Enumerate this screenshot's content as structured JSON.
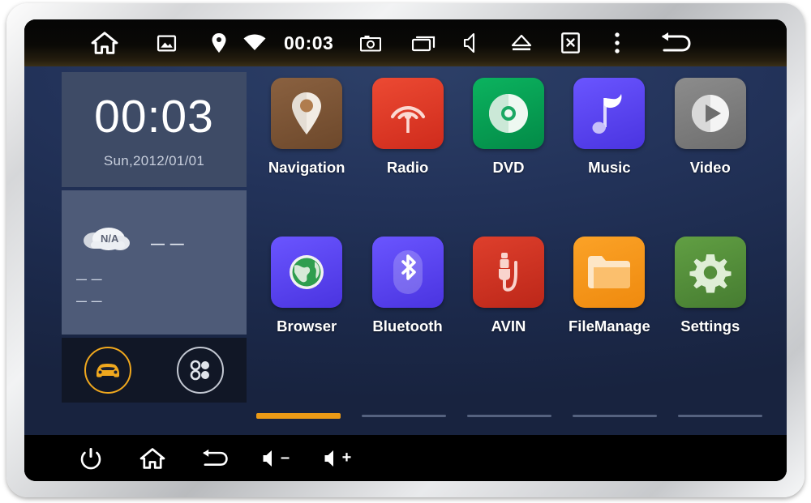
{
  "status_bar": {
    "clock": "00:03",
    "icons_left": [
      {
        "name": "home-icon",
        "label": "Home"
      },
      {
        "name": "wallpaper-icon",
        "label": "Wallpaper"
      }
    ],
    "icons_center": [
      {
        "name": "location-pin-icon",
        "label": "GPS"
      },
      {
        "name": "wifi-icon",
        "label": "Wi-Fi"
      }
    ],
    "icons_right": [
      {
        "name": "screenshot-icon",
        "label": "Screenshot"
      },
      {
        "name": "recent-apps-icon",
        "label": "Recent apps"
      },
      {
        "name": "mute-icon",
        "label": "Mute"
      },
      {
        "name": "eject-icon",
        "label": "Eject"
      },
      {
        "name": "screen-off-icon",
        "label": "Screen off"
      },
      {
        "name": "overflow-menu-icon",
        "label": "More"
      },
      {
        "name": "back-icon",
        "label": "Back"
      }
    ]
  },
  "widgets": {
    "clock": {
      "time": "00:03",
      "date": "Sun,2012/01/01"
    },
    "weather": {
      "condition": "N/A",
      "temperature": "— —",
      "low": "— —",
      "high": "— —",
      "icon": "cloud-icon"
    },
    "dock": [
      {
        "name": "car-mode-button",
        "icon": "car-icon",
        "active": true,
        "color": "#f0a81e"
      },
      {
        "name": "all-apps-button",
        "icon": "apps-grid-icon",
        "active": false,
        "color": "#c3c8d2"
      }
    ]
  },
  "apps": {
    "rows": [
      [
        {
          "label": "Navigation",
          "icon": "map-pin-icon",
          "bg": "#7b5434",
          "fg": "#f3ece4"
        },
        {
          "label": "Radio",
          "icon": "radio-waves-icon",
          "bg": "#e03a25",
          "fg": "#fbd9d2"
        },
        {
          "label": "DVD",
          "icon": "disc-icon",
          "bg": "#06a154",
          "fg": "#eaf7ef"
        },
        {
          "label": "Music",
          "icon": "music-note-icon",
          "bg": "#5846f0",
          "fg": "#e4e0fd"
        },
        {
          "label": "Video",
          "icon": "play-circle-icon",
          "bg": "#7c7c7c",
          "fg": "#f0f0f0"
        }
      ],
      [
        {
          "label": "Browser",
          "icon": "globe-icon",
          "bg": "#5846f0",
          "fg": "#3fa85a"
        },
        {
          "label": "Bluetooth",
          "icon": "bluetooth-icon",
          "bg": "#5846f0",
          "fg": "#ded9fb"
        },
        {
          "label": "AVIN",
          "icon": "av-plug-icon",
          "bg": "#d03324",
          "fg": "#f9d4cd"
        },
        {
          "label": "FileManage",
          "icon": "folder-icon",
          "bg": "#f2951b",
          "fg": "#fde6c6"
        },
        {
          "label": "Settings",
          "icon": "gear-icon",
          "bg": "#54913a",
          "fg": "#dfeed6"
        }
      ]
    ]
  },
  "pager": {
    "pages": 5,
    "active_page": 1,
    "active_color": "#eb9a16",
    "inactive_color": "#55627f"
  },
  "nav_bar": {
    "buttons": [
      {
        "name": "power-button",
        "icon": "power-icon",
        "label": "Power"
      },
      {
        "name": "home-button",
        "icon": "home-icon",
        "label": "Home"
      },
      {
        "name": "back-button",
        "icon": "back-arrow-icon",
        "label": "Back"
      },
      {
        "name": "volume-down-button",
        "icon": "speaker-minus-icon",
        "label": "Volume down",
        "sign": "–"
      },
      {
        "name": "volume-up-button",
        "icon": "speaker-plus-icon",
        "label": "Volume up",
        "sign": "+"
      }
    ]
  },
  "theme": {
    "wallpaper": "#23335a",
    "bezel": "#d6d7d9",
    "status_bar_bg": "#0a0906"
  }
}
